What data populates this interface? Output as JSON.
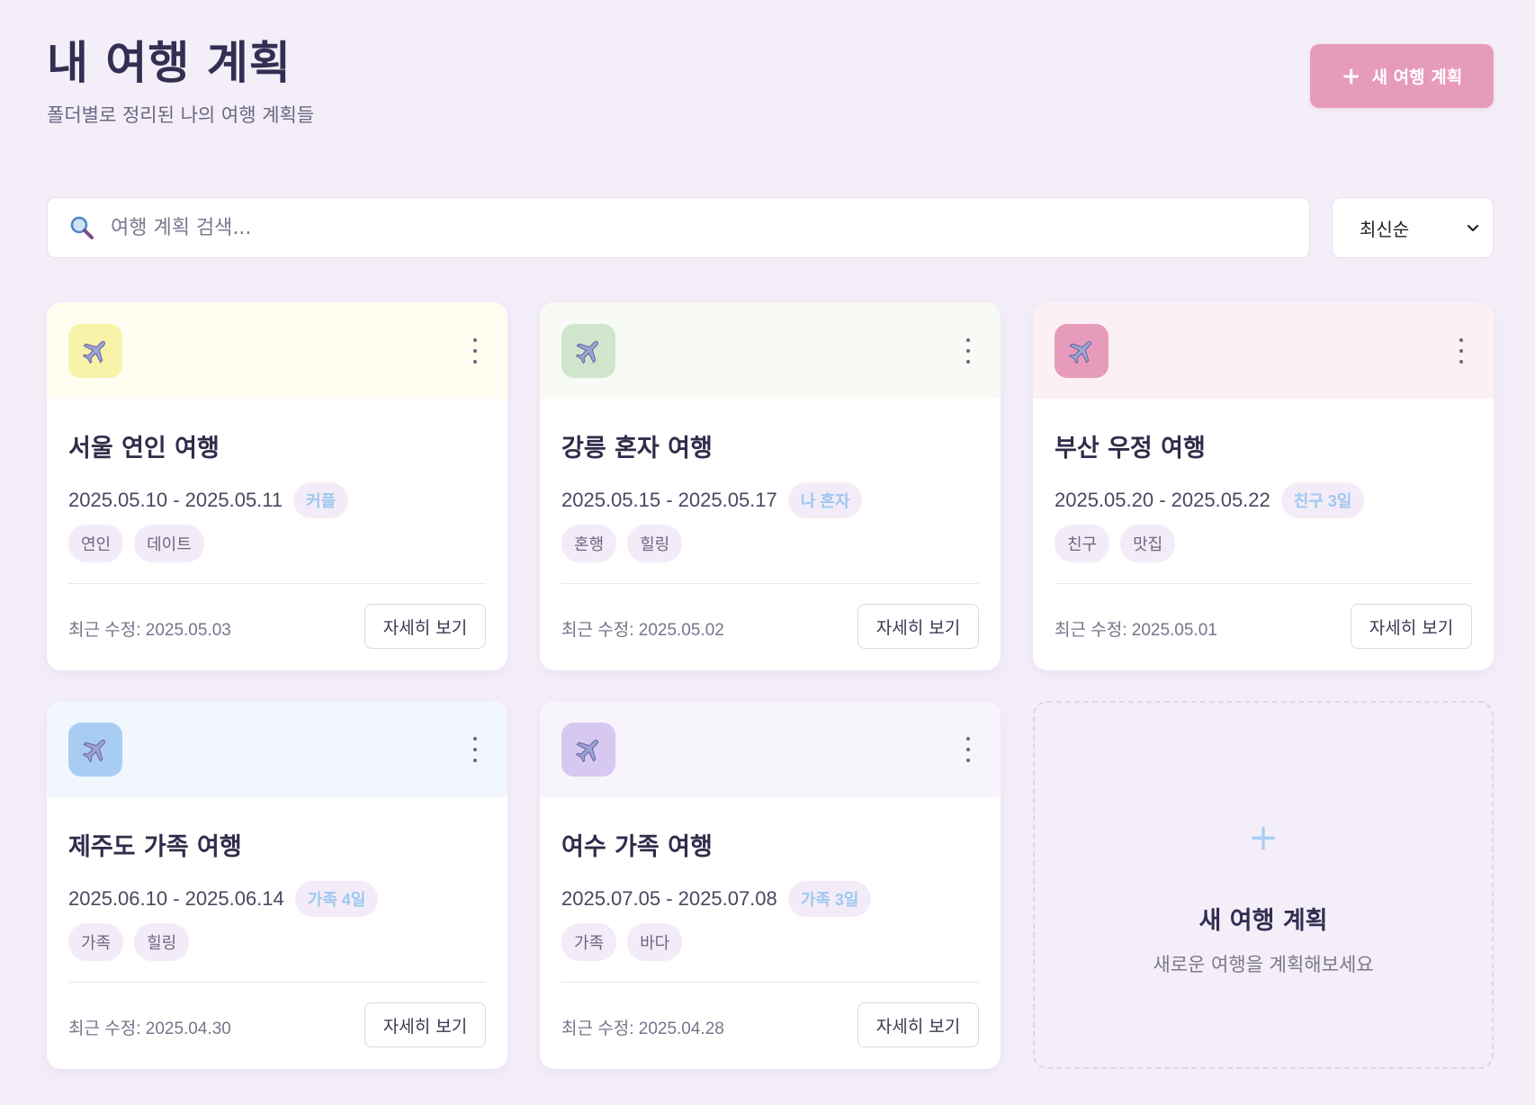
{
  "header": {
    "title": "내 여행 계획",
    "subtitle": "폴더별로 정리된 나의 여행 계획들",
    "new_plan_plus": "+",
    "new_plan_label": "새 여행 계획"
  },
  "search": {
    "icon": "search-icon",
    "placeholder": "여행 계획 검색...",
    "value": ""
  },
  "sort": {
    "selected": "최신순",
    "arrow": "⌄"
  },
  "colors": {
    "accent": "#e79bba",
    "background": "#f4eef9",
    "badge_text": "#9ec8f0"
  },
  "cards": [
    {
      "icon": "airplane-icon",
      "title": "서울 연인 여행",
      "dates": "2025.05.10 - 2025.05.11",
      "badge": "커플",
      "tags": [
        "연인",
        "데이트"
      ],
      "modified": "최근 수정: 2025.05.03",
      "details_label": "자세히 보기",
      "head_color": "#fefdf0",
      "tile_color": "#f7f3a8"
    },
    {
      "icon": "airplane-icon",
      "title": "강릉 혼자 여행",
      "dates": "2025.05.15 - 2025.05.17",
      "badge": "나 혼자",
      "tags": [
        "혼행",
        "힐링"
      ],
      "modified": "최근 수정: 2025.05.02",
      "details_label": "자세히 보기",
      "head_color": "#f7faf5",
      "tile_color": "#cfe6cc"
    },
    {
      "icon": "airplane-icon",
      "title": "부산 우정 여행",
      "dates": "2025.05.20 - 2025.05.22",
      "badge": "친구 3일",
      "tags": [
        "친구",
        "맛집"
      ],
      "modified": "최근 수정: 2025.05.01",
      "details_label": "자세히 보기",
      "head_color": "#fdf0f4",
      "tile_color": "#e79bba"
    },
    {
      "icon": "airplane-icon",
      "title": "제주도 가족 여행",
      "dates": "2025.06.10 - 2025.06.14",
      "badge": "가족 4일",
      "tags": [
        "가족",
        "힐링"
      ],
      "modified": "최근 수정: 2025.04.30",
      "details_label": "자세히 보기",
      "head_color": "#f1f7fd",
      "tile_color": "#a9cdf2"
    },
    {
      "icon": "airplane-icon",
      "title": "여수 가족 여행",
      "dates": "2025.07.05 - 2025.07.08",
      "badge": "가족 3일",
      "tags": [
        "가족",
        "바다"
      ],
      "modified": "최근 수정: 2025.04.28",
      "details_label": "자세히 보기",
      "head_color": "#f8f4fc",
      "tile_color": "#d6c8f0"
    }
  ],
  "new_card": {
    "plus": "+",
    "title": "새 여행 계획",
    "subtitle": "새로운 여행을 계획해보세요"
  }
}
